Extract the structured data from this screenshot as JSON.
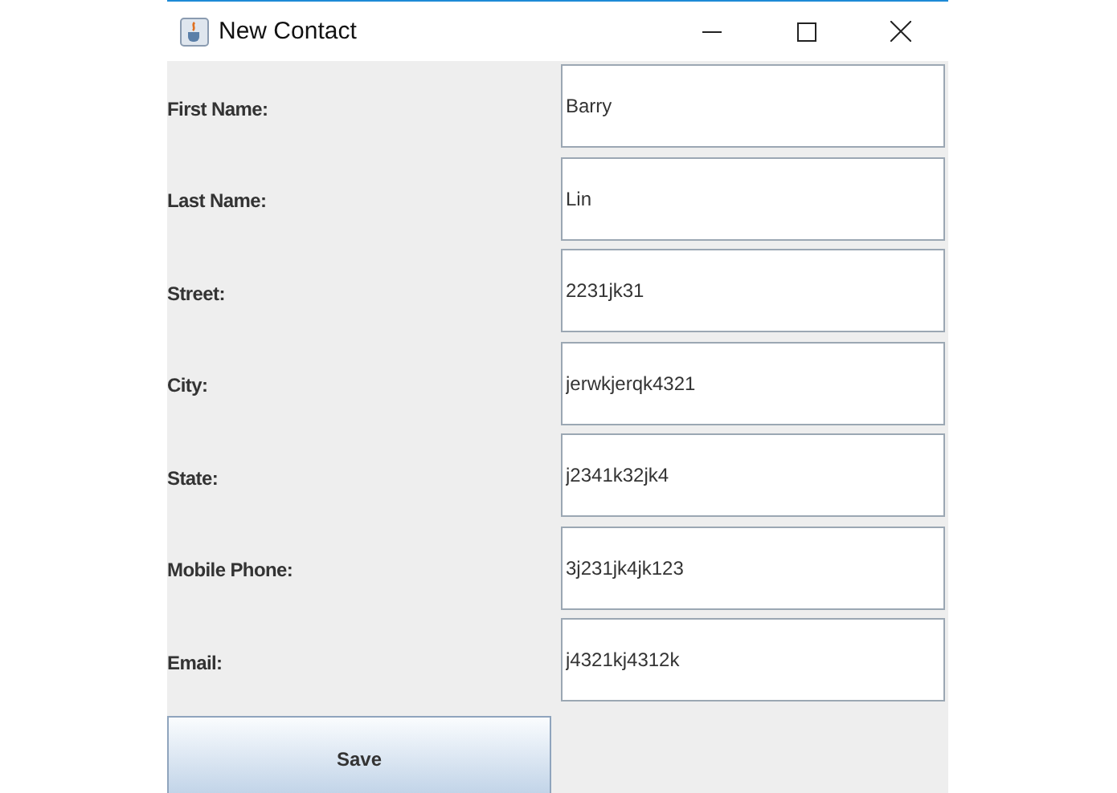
{
  "window": {
    "title": "New Contact"
  },
  "fields": [
    {
      "label": "First Name:",
      "value": "Barry"
    },
    {
      "label": "Last Name:",
      "value": "Lin"
    },
    {
      "label": "Street:",
      "value": "2231jk31"
    },
    {
      "label": "City:",
      "value": "jerwkjerqk4321"
    },
    {
      "label": "State:",
      "value": "j2341k32jk4"
    },
    {
      "label": "Mobile Phone:",
      "value": "3j231jk4jk123"
    },
    {
      "label": "Email:",
      "value": "j4321kj4312k"
    }
  ],
  "buttons": [
    "Save"
  ]
}
